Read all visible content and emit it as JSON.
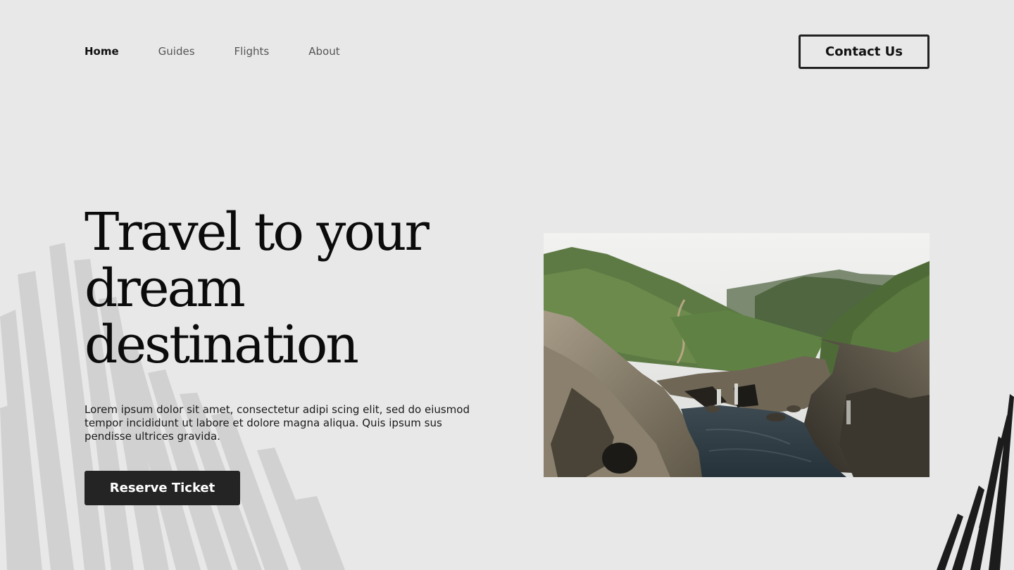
{
  "nav": {
    "items": [
      {
        "label": "Home",
        "active": true
      },
      {
        "label": "Guides",
        "active": false
      },
      {
        "label": "Flights",
        "active": false
      },
      {
        "label": "About",
        "active": false
      }
    ],
    "contact_label": "Contact Us"
  },
  "hero": {
    "title_lines": [
      "Travel to your",
      "dream",
      "destination"
    ],
    "description": "Lorem ipsum dolor sit amet, consectetur adipi scing elit, sed do eiusmod tempor incididunt ut labore et dolore magna aliqua. Quis ipsum sus pendisse ultrices gravida.",
    "cta_label": "Reserve Ticket"
  },
  "colors": {
    "background": "#e7e8e7",
    "primary_dark": "#242424",
    "brush_light": "#cfd0cf"
  },
  "icons": {
    "decoration_left": "brush-stroke-decoration",
    "decoration_right": "brush-stroke-decoration"
  }
}
